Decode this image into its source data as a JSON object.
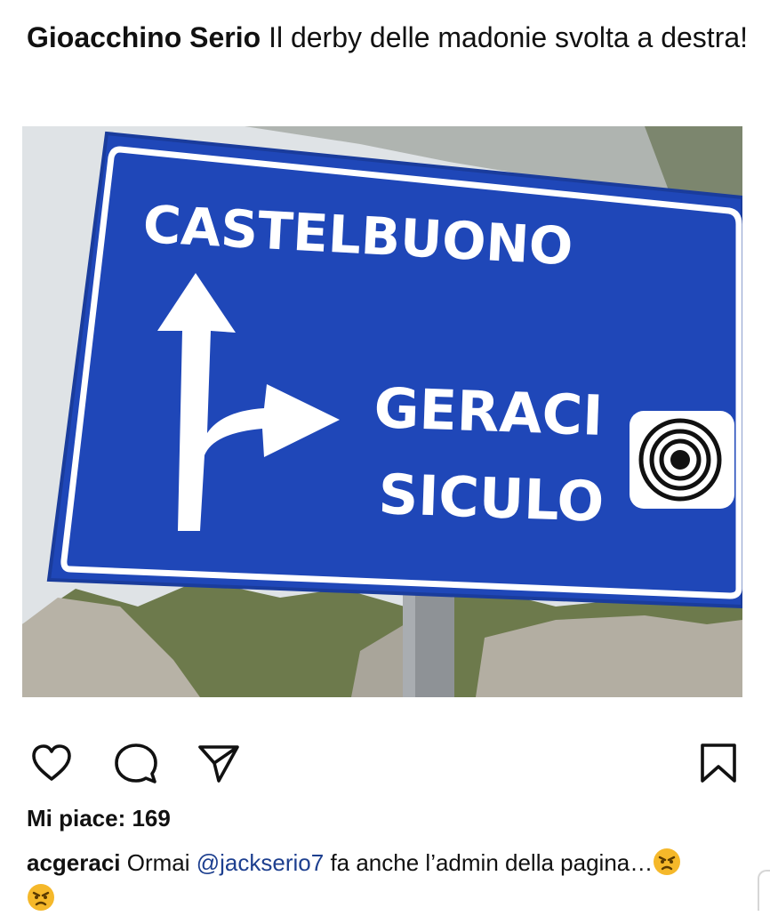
{
  "post": {
    "author": "Gioacchino Serio",
    "caption": " Il derby delle madonie svolta a destra!"
  },
  "photo": {
    "sign": {
      "top_destination": "CASTELBUONO",
      "right_destination_line1": "GERACI",
      "right_destination_line2": "SICULO"
    },
    "colors": {
      "sign_blue": "#1f47b8",
      "sky": "#dfe3e6",
      "rock": "#a9a59a"
    }
  },
  "actions": {
    "like_icon": "heart-icon",
    "comment_icon": "comment-bubble-icon",
    "share_icon": "paper-plane-icon",
    "save_icon": "bookmark-icon"
  },
  "likes": {
    "text": "Mi piace: 169"
  },
  "comment": {
    "username": "acgeraci",
    "text_before": " Ormai ",
    "mention": "@jackserio7",
    "text_after": " fa anche l’admin della pagina…",
    "emoji": "angry-face-emoji"
  }
}
